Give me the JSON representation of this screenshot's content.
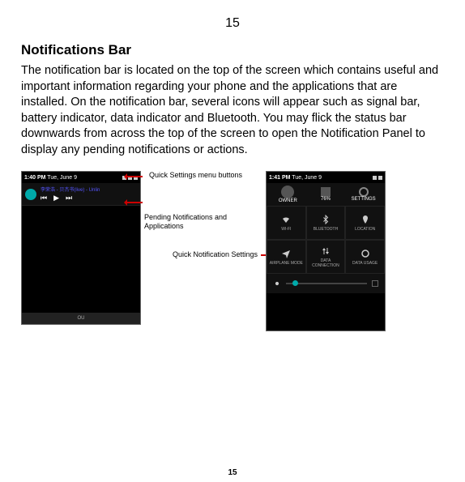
{
  "page_number_top": "15",
  "page_number_bottom": "15",
  "heading": "Notifications Bar",
  "body": "The notification bar is located on the top of the screen which contains useful and important information regarding your phone and the applications that are installed. On the notification bar, several icons will appear such as signal bar, battery indicator, data indicator and Bluetooth. You may flick the status bar downwards from across the top of the screen to open the Notification Panel to display any pending notifications or actions.",
  "labels": {
    "qs_buttons": "Quick Settings menu buttons",
    "pending": "Pending Notifications and Applications",
    "qn_settings": "Quick Notification Settings"
  },
  "left_phone": {
    "time": "1:40 PM",
    "date": "Tue, June 9",
    "notif_text": "李荣浩 - 贝杰书(live) - Unlin",
    "footer": "OU"
  },
  "right_phone": {
    "time": "1:41 PM",
    "date": "Tue, June 9",
    "head": {
      "owner": "OWNER",
      "battery": "76%",
      "settings": "SETTINGS"
    },
    "tiles": [
      {
        "label": "WI-FI"
      },
      {
        "label": "BLUETOOTH"
      },
      {
        "label": "LOCATION"
      },
      {
        "label": "AIRPLANE MODE"
      },
      {
        "label": "DATA CONNECTION"
      },
      {
        "label": "DATA USAGE"
      }
    ]
  }
}
